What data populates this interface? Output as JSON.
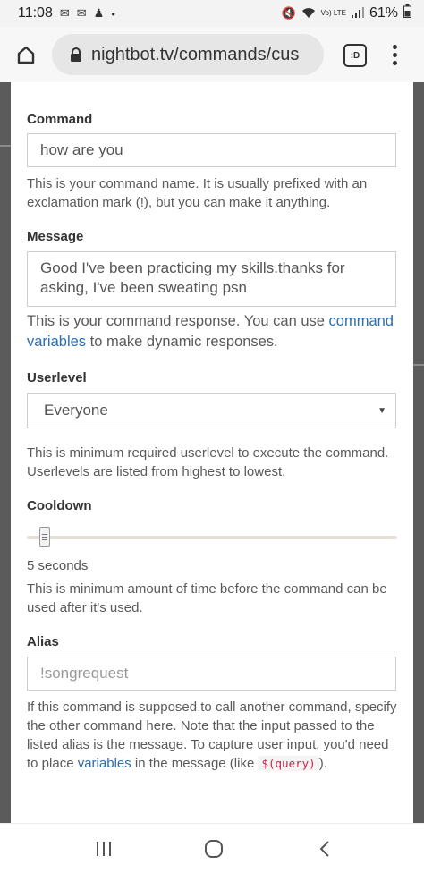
{
  "status_bar": {
    "time": "11:08",
    "battery": "61%",
    "network_label": "Vo) LTE"
  },
  "browser": {
    "url": "nightbot.tv/commands/cus",
    "tab_icon_label": ":D"
  },
  "form": {
    "command": {
      "label": "Command",
      "value": "how are you",
      "help": "This is your command name. It is usually prefixed with an exclamation mark (!), but you can make it anything."
    },
    "message": {
      "label": "Message",
      "value": "Good I've been practicing my skills.thanks for asking, I've been sweating psn",
      "help_before": "This is your command response. You can use ",
      "help_link": "command variables",
      "help_after": " to make dynamic responses."
    },
    "userlevel": {
      "label": "Userlevel",
      "selected": "Everyone",
      "help": "This is minimum required userlevel to execute the command. Userlevels are listed from highest to lowest."
    },
    "cooldown": {
      "label": "Cooldown",
      "value_text": "5 seconds",
      "slider_fraction": 0.05,
      "help": "This is minimum amount of time before the command can be used after it's used."
    },
    "alias": {
      "label": "Alias",
      "placeholder": "!songrequest",
      "help_before": "If this command is supposed to call another command, specify the other command here. Note that the input passed to the listed alias is the message. To capture user input, you'd need to place ",
      "help_link": "variables",
      "help_mid": " in the message (like ",
      "help_code": "$(query)",
      "help_after": ")."
    }
  },
  "icons": {
    "home": "home-icon",
    "lock": "lock-icon",
    "menu": "more-vert-icon",
    "recent": "recent-apps-icon",
    "home_nav": "home-nav-icon",
    "back": "back-icon"
  }
}
